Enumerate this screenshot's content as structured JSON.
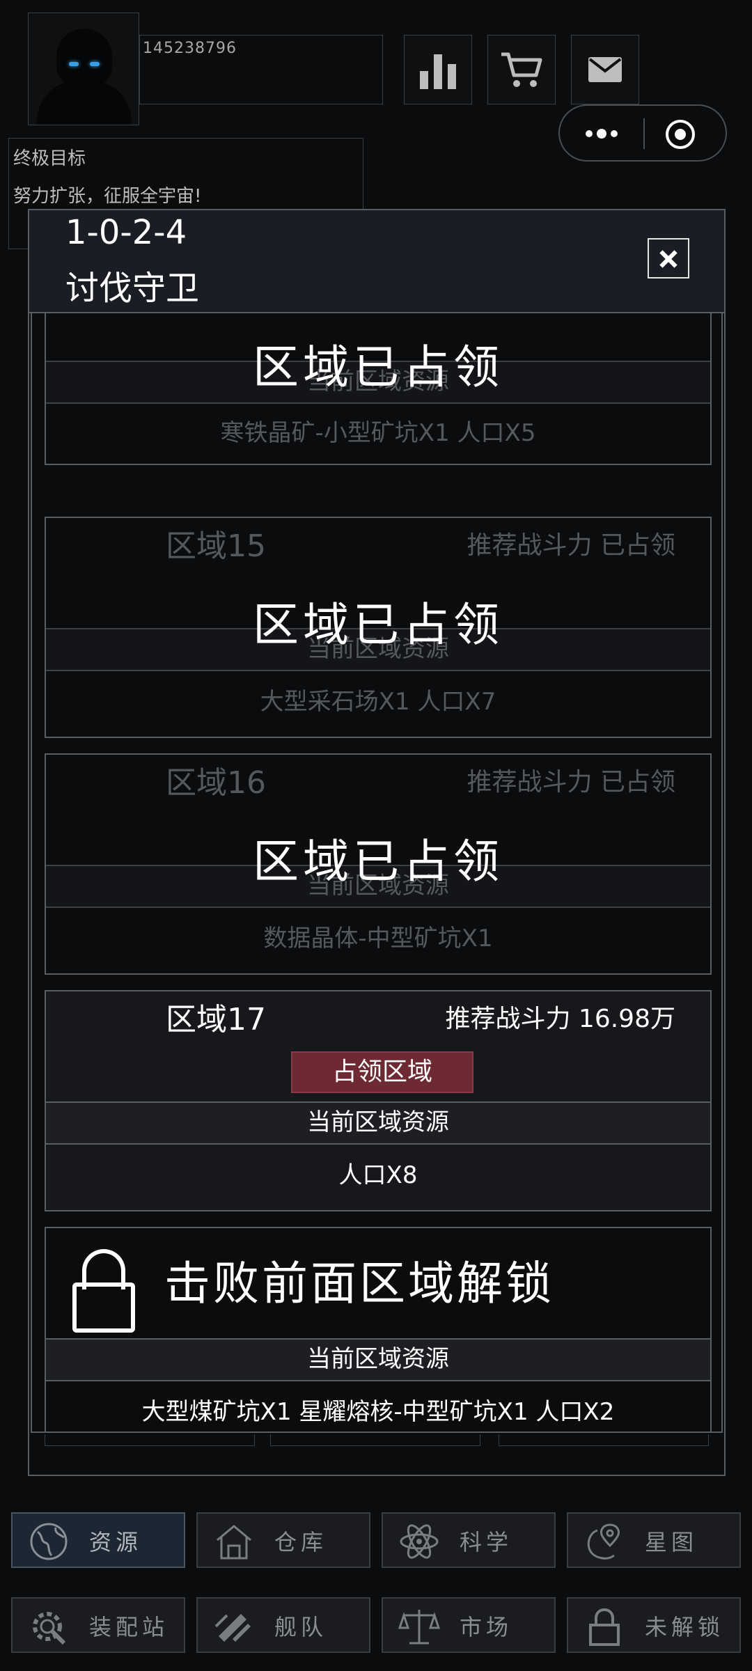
{
  "user": {
    "id": "145238796"
  },
  "goal": {
    "title": "终极目标",
    "text": "努力扩张，征服全宇宙!"
  },
  "top_icons": [
    "bar-chart-icon",
    "cart-icon",
    "mail-icon"
  ],
  "mini_program": {
    "more": "more-dots-icon",
    "close": "target-icon"
  },
  "modal": {
    "code": "1-0-2-4",
    "title": "讨伐守卫",
    "occupied_label": "区域已占领",
    "resources_title": "当前区域资源",
    "regions": [
      {
        "name": "",
        "power": "",
        "resources": "寒铁晶矿-小型矿坑X1   人口X5"
      },
      {
        "name": "区域15",
        "power": "推荐战斗力 已占领",
        "resources": "大型采石场X1   人口X7"
      },
      {
        "name": "区域16",
        "power": "推荐战斗力 已占领",
        "resources": "数据晶体-中型矿坑X1"
      }
    ],
    "current": {
      "name": "区域17",
      "power": "推荐战斗力 16.98万",
      "button": "占领区域",
      "resources": "人口X8"
    },
    "locked": {
      "text": "击败前面区域解锁",
      "resources": "大型煤矿坑X1   星耀熔核-中型矿坑X1   人口X2"
    }
  },
  "nav": [
    {
      "label": "资源",
      "icon": "globe-icon",
      "active": true
    },
    {
      "label": "仓库",
      "icon": "warehouse-icon",
      "active": false
    },
    {
      "label": "科学",
      "icon": "atom-icon",
      "active": false
    },
    {
      "label": "星图",
      "icon": "map-pin-icon",
      "active": false
    },
    {
      "label": "装配站",
      "icon": "gear-wrench-icon",
      "active": false
    },
    {
      "label": "舰队",
      "icon": "fleet-icon",
      "active": false
    },
    {
      "label": "市场",
      "icon": "scale-icon",
      "active": false
    },
    {
      "label": "未解锁",
      "icon": "lock-icon",
      "active": false
    }
  ],
  "colors": {
    "accent": "#6d2a33",
    "background": "#0b0c0d",
    "panel": "#1b1d24"
  }
}
